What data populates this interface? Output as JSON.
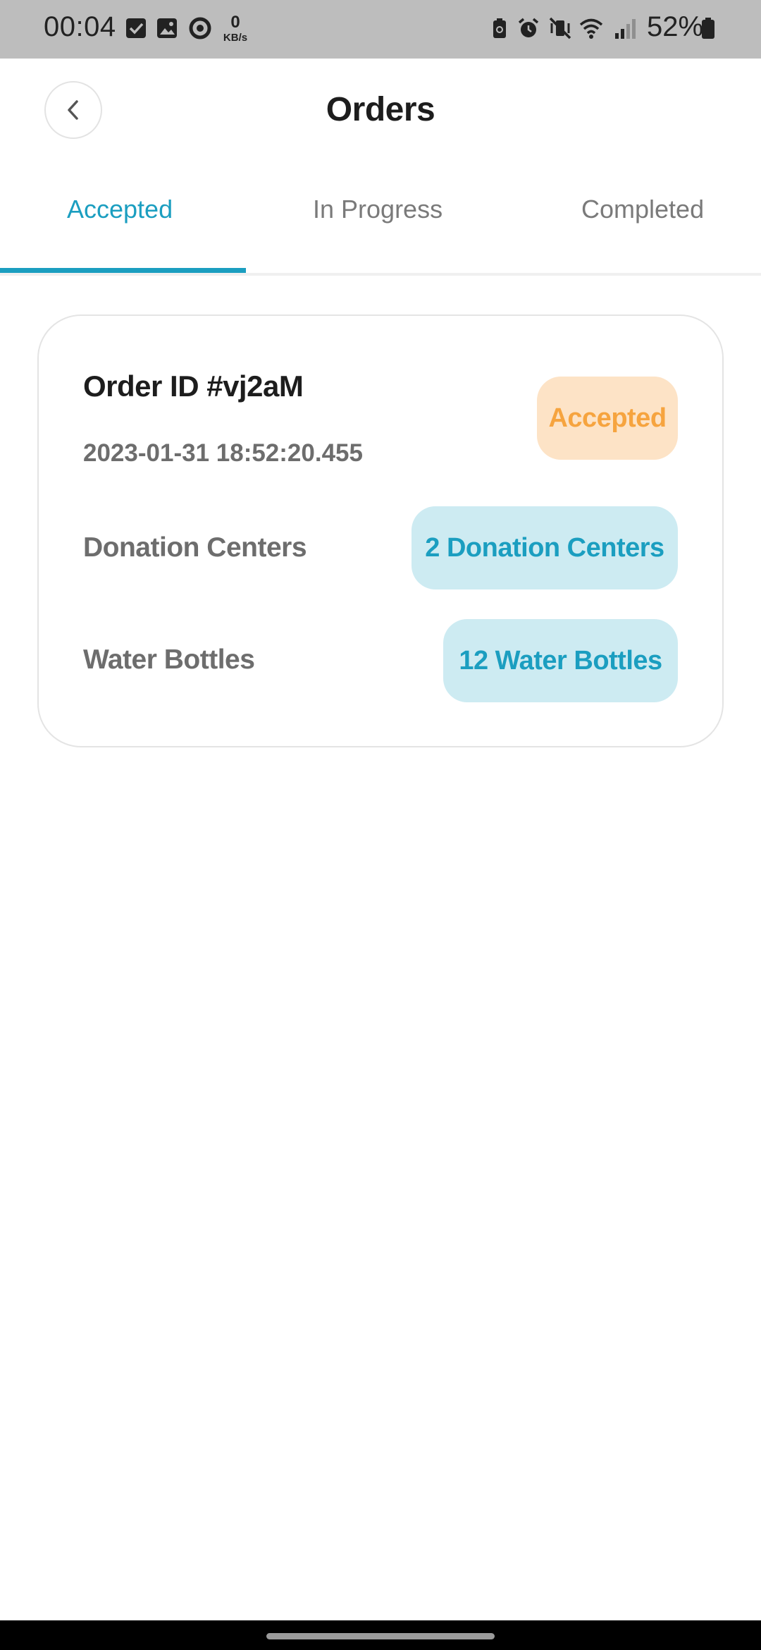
{
  "status_bar": {
    "time": "00:04",
    "net_speed_value": "0",
    "net_speed_unit": "KB/s",
    "battery_percent": "52%"
  },
  "header": {
    "title": "Orders"
  },
  "tabs": [
    {
      "label": "Accepted",
      "active": true
    },
    {
      "label": "In Progress",
      "active": false
    },
    {
      "label": "Completed",
      "active": false
    }
  ],
  "order": {
    "id_label": "Order ID #vj2aM",
    "timestamp": "2023-01-31 18:52:20.455",
    "status": "Accepted",
    "donation_centers_label": "Donation Centers",
    "donation_centers_value": "2  Donation Centers",
    "water_bottles_label": "Water Bottles",
    "water_bottles_value": "12 Water Bottles"
  },
  "colors": {
    "accent": "#1b9ec0",
    "status_accepted_bg": "#fde3c6",
    "status_accepted_text": "#f6a43f",
    "info_pill_bg": "#cdebf2"
  }
}
